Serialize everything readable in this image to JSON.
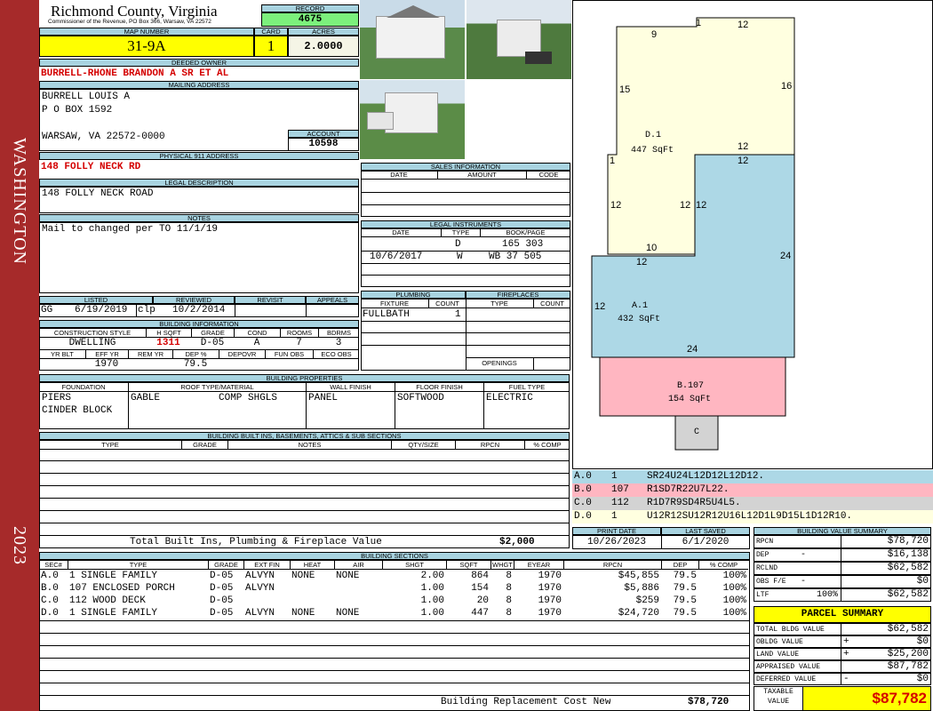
{
  "sidebar": {
    "county_word": "WASHINGTON",
    "year": "2023"
  },
  "header": {
    "county": "Richmond County, Virginia",
    "commissioner": "Commissioner of the Revenue, PO Box 366, Warsaw, VA 22572",
    "record_label": "RECORD",
    "record": "4675",
    "map_label": "MAP NUMBER",
    "map": "31-9A",
    "card_label": "CARD",
    "card": "1",
    "acres_label": "ACRES",
    "acres": "2.0000"
  },
  "owner": {
    "label": "DEEDED OWNER",
    "name": "BURRELL-RHONE BRANDON A SR ET AL"
  },
  "mailing": {
    "label": "MAILING ADDRESS",
    "line1": "BURRELL LOUIS A",
    "line2": "P O BOX 1592",
    "line3": "WARSAW, VA 22572-0000",
    "account_label": "ACCOUNT",
    "account": "10598"
  },
  "physical": {
    "label": "PHYSICAL 911 ADDRESS",
    "address": "148 FOLLY NECK RD"
  },
  "legal": {
    "label": "LEGAL DESCRIPTION",
    "text": "148 FOLLY NECK ROAD"
  },
  "notes": {
    "label": "NOTES",
    "text": "Mail to changed per TO 11/1/19"
  },
  "listing": {
    "listed_label": "LISTED",
    "reviewed_label": "REVIEWED",
    "revisit_label": "REVISIT",
    "appeals_label": "APPEALS",
    "listed_by": "GG",
    "listed_date": "6/19/2019",
    "reviewed_by": "clp",
    "reviewed_date": "10/2/2014"
  },
  "building_info": {
    "label": "BUILDING INFORMATION",
    "h": [
      "CONSTRUCTION STYLE",
      "H SQFT",
      "GRADE",
      "COND",
      "ROOMS",
      "BDRMS"
    ],
    "v": [
      "DWELLING",
      "1311",
      "D-05",
      "A",
      "7",
      "3"
    ],
    "h2": [
      "YR BLT",
      "EFF YR",
      "REM YR",
      "DEP %",
      "DEPOVR",
      "FUN OBS",
      "ECO OBS"
    ],
    "v2": [
      "",
      "1970",
      "",
      "79.5",
      "",
      "",
      ""
    ]
  },
  "sales": {
    "label": "SALES INFORMATION",
    "h": [
      "DATE",
      "AMOUNT",
      "CODE"
    ]
  },
  "legal_instr": {
    "label": "LEGAL INSTRUMENTS",
    "h": [
      "DATE",
      "TYPE",
      "BOOK/PAGE"
    ],
    "rows": [
      [
        "",
        "D",
        "165 303"
      ],
      [
        "10/6/2017",
        "W",
        "WB 37 505"
      ]
    ]
  },
  "plumbing": {
    "label": "PLUMBING",
    "h": [
      "FIXTURE",
      "COUNT"
    ],
    "fixture": "FULLBATH",
    "count": "1"
  },
  "fireplaces": {
    "label": "FIREPLACES",
    "h": [
      "TYPE",
      "COUNT"
    ],
    "openings": "OPENINGS"
  },
  "properties": {
    "label": "BUILDING PROPERTIES",
    "h": [
      "FOUNDATION",
      "ROOF TYPE/MATERIAL",
      "WALL FINISH",
      "FLOOR FINISH",
      "FUEL TYPE"
    ],
    "foundation1": "PIERS",
    "foundation2": "CINDER BLOCK",
    "roof_type": "GABLE",
    "roof_mat": "COMP SHGLS",
    "wall": "PANEL",
    "floor": "SOFTWOOD",
    "fuel": "ELECTRIC"
  },
  "builtins": {
    "label": "BUILDING BUILT INS, BASEMENTS, ATTICS & SUB SECTIONS",
    "h": [
      "TYPE",
      "GRADE",
      "NOTES",
      "QTY/SIZE",
      "RPCN",
      "% COMP"
    ],
    "total_label": "Total Built Ins, Plumbing & Fireplace Value",
    "total": "$2,000"
  },
  "print": {
    "print_label": "PRINT DATE",
    "print": "10/26/2023",
    "saved_label": "LAST SAVED",
    "saved": "6/1/2020"
  },
  "sections": {
    "label": "BUILDING SECTIONS",
    "h": [
      "SEC#",
      "TYPE",
      "GRADE",
      "EXT FIN",
      "HEAT",
      "AIR",
      "SHGT",
      "SQFT",
      "WHGT",
      "EYEAR",
      "RPCN",
      "DEP",
      "% COMP"
    ],
    "rows": [
      [
        "A.0",
        "1 SINGLE FAMILY",
        "D-05",
        "ALVYN",
        "NONE",
        "NONE",
        "2.00",
        "864",
        "8",
        "1970",
        "$45,855",
        "79.5",
        "100%"
      ],
      [
        "B.0",
        "107 ENCLOSED PORCH",
        "D-05",
        "ALVYN",
        "",
        "",
        "1.00",
        "154",
        "8",
        "1970",
        "$5,886",
        "79.5",
        "100%"
      ],
      [
        "C.0",
        "112 WOOD DECK",
        "D-05",
        "",
        "",
        "",
        "1.00",
        "20",
        "8",
        "1970",
        "$259",
        "79.5",
        "100%"
      ],
      [
        "D.0",
        "1 SINGLE FAMILY",
        "D-05",
        "ALVYN",
        "NONE",
        "NONE",
        "1.00",
        "447",
        "8",
        "1970",
        "$24,720",
        "79.5",
        "100%"
      ]
    ],
    "repl_label": "Building Replacement Cost New",
    "repl": "$78,720"
  },
  "sketch": {
    "labels": {
      "d1": "D.1",
      "d1sq": "447 SqFt",
      "a1": "A.1",
      "a1sq": "432 SqFt",
      "b107": "B.107",
      "b107sq": "154 SqFt",
      "c": "C"
    },
    "dims": [
      "9",
      "1",
      "12",
      "15",
      "16",
      "12",
      "1",
      "12",
      "12",
      "12",
      "12",
      "10",
      "12",
      "24",
      "12",
      "24"
    ],
    "vectors": [
      [
        "A.0",
        "1",
        "SR24U24L12D12L12D12."
      ],
      [
        "B.0",
        "107",
        "R1SD7R22U7L22."
      ],
      [
        "C.0",
        "112",
        "R1D7R9SD4R5U4L5."
      ],
      [
        "D.0",
        "1",
        "U12R12SU12R12U16L12D1L9D15L1D12R10."
      ]
    ],
    "colors": {
      "a": "#add8e6",
      "b": "#ffb6c1",
      "c": "#d3d3d3",
      "d": "#ffffe0"
    }
  },
  "value_summary": {
    "label": "BUILDING VALUE SUMMARY",
    "rows": [
      [
        "RPCN",
        "",
        "$78,720"
      ],
      [
        "DEP",
        "-",
        "$16,138"
      ],
      [
        "RCLND",
        "",
        "$62,582"
      ],
      [
        "OBS F/E",
        "-",
        "$0"
      ],
      [
        "LTF",
        "100%",
        "$62,582"
      ]
    ]
  },
  "parcel": {
    "label": "PARCEL SUMMARY",
    "rows": [
      [
        "TOTAL BLDG VALUE",
        "",
        "$62,582"
      ],
      [
        "OBLDG VALUE",
        "+",
        "$0"
      ],
      [
        "LAND VALUE",
        "+",
        "$25,200"
      ],
      [
        "APPRAISED VALUE",
        "",
        "$87,782"
      ],
      [
        "DEFERRED VALUE",
        "-",
        "$0"
      ]
    ],
    "taxable_label1": "TAXABLE",
    "taxable_label2": "VALUE",
    "taxable": "$87,782"
  }
}
